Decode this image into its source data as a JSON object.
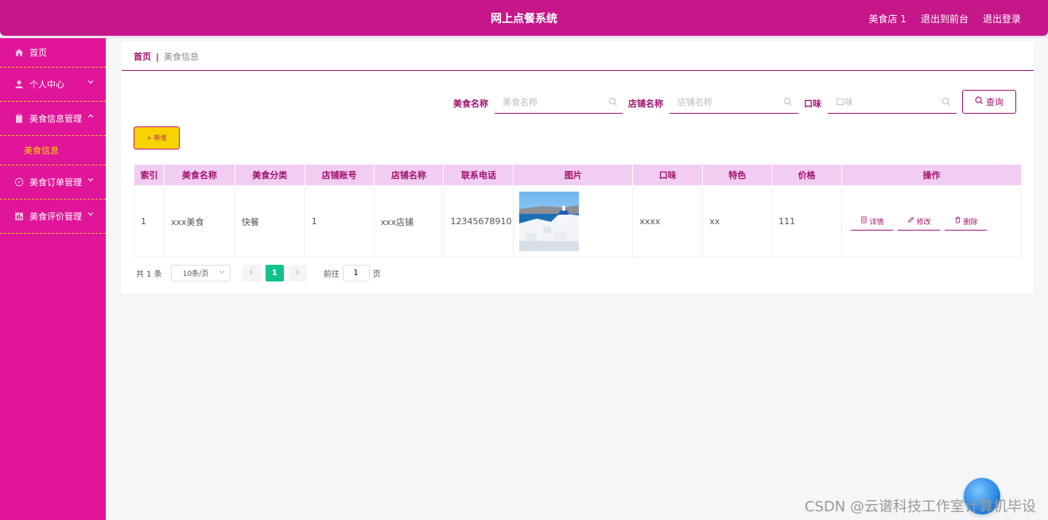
{
  "header": {
    "title": "网上点餐系统",
    "store_name": "美食店 1",
    "back_to_front": "退出到前台",
    "logout": "退出登录"
  },
  "sidebar": {
    "items": [
      {
        "label": "首页",
        "icon": "home-icon"
      },
      {
        "label": "个人中心",
        "icon": "user-icon",
        "chevron": "down"
      },
      {
        "label": "美食信息管理",
        "icon": "clipboard-icon",
        "chevron": "up"
      },
      {
        "label": "美食信息",
        "sub": true
      },
      {
        "label": "美食订单管理",
        "icon": "compass-icon",
        "chevron": "down"
      },
      {
        "label": "美食评价管理",
        "icon": "chart-icon",
        "chevron": "down"
      }
    ]
  },
  "breadcrumb": {
    "home": "首页",
    "separator": "|",
    "current": "美食信息"
  },
  "search": {
    "food_name_label": "美食名称",
    "food_name_placeholder": "美食名称",
    "shop_name_label": "店铺名称",
    "shop_name_placeholder": "店铺名称",
    "taste_label": "口味",
    "taste_placeholder": "口味",
    "query_label": "查询"
  },
  "toolbar": {
    "add_label": "+ 新增"
  },
  "table": {
    "headers": [
      "索引",
      "美食名称",
      "美食分类",
      "店铺账号",
      "店铺名称",
      "联系电话",
      "图片",
      "口味",
      "特色",
      "价格",
      "操作"
    ],
    "rows": [
      {
        "index": "1",
        "food_name": "xxx美食",
        "category": "快餐",
        "shop_account": "1",
        "shop_name": "xxx店铺",
        "phone": "12345678910",
        "taste": "xxxx",
        "feature": "xx",
        "price": "111"
      }
    ],
    "actions": {
      "detail": "详情",
      "edit": "修改",
      "delete": "删除"
    }
  },
  "pagination": {
    "total_text": "共 1 条",
    "page_size": "10条/页",
    "current_page": "1",
    "goto_label": "前往",
    "goto_value": "1",
    "page_unit": "页"
  },
  "watermark": "CSDN @云谱科技工作室计算机毕设",
  "colors": {
    "header": "#c5168a",
    "sidebar": "#e0159a",
    "accent": "#a0136e",
    "submenu_active": "#ffd400",
    "table_header": "#f2cdf2",
    "page_active": "#13c28a"
  }
}
